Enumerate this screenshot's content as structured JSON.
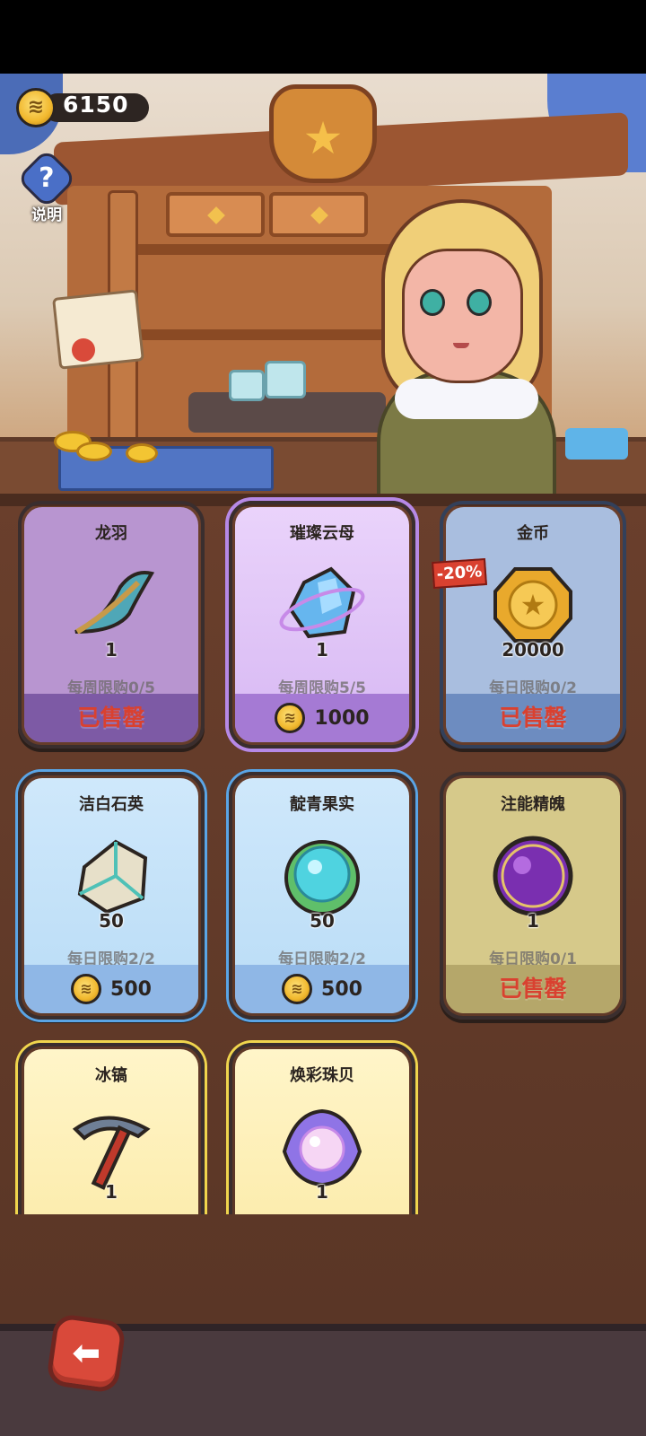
{
  "hud": {
    "currency_icon": "gold-crystal-coin-icon",
    "currency_value": "6150",
    "help_label": "说明",
    "help_icon": "question-icon"
  },
  "shop": {
    "items": [
      {
        "name": "龙羽",
        "icon": "dragon-feather-icon",
        "qty": "1",
        "limit": "每周限购0/5",
        "status": "sold",
        "sold_label": "已售罄",
        "theme": "purple"
      },
      {
        "name": "璀璨云母",
        "icon": "mica-crystal-icon",
        "qty": "1",
        "limit": "每周限购5/5",
        "status": "price",
        "price": "1000",
        "theme": "violet"
      },
      {
        "name": "金币",
        "icon": "gold-coin-star-icon",
        "qty": "20000",
        "limit": "每日限购0/2",
        "status": "sold",
        "sold_label": "已售罄",
        "discount": "-20%",
        "theme": "blue"
      },
      {
        "name": "洁白石英",
        "icon": "white-quartz-icon",
        "qty": "50",
        "limit": "每日限购2/2",
        "status": "price",
        "price": "500",
        "theme": "sky"
      },
      {
        "name": "靛青果实",
        "icon": "indigo-fruit-icon",
        "qty": "50",
        "limit": "每日限购2/2",
        "status": "price",
        "price": "500",
        "theme": "sky"
      },
      {
        "name": "注能精魄",
        "icon": "energy-orb-icon",
        "qty": "1",
        "limit": "每日限购0/1",
        "status": "sold",
        "sold_label": "已售罄",
        "theme": "olive"
      },
      {
        "name": "冰镐",
        "icon": "ice-pickaxe-icon",
        "qty": "1",
        "theme": "yellow"
      },
      {
        "name": "焕彩珠贝",
        "icon": "pearl-shell-icon",
        "qty": "1",
        "theme": "yellow"
      }
    ]
  },
  "nav": {
    "back_icon": "back-arrow-icon",
    "back_glyph": "⬅"
  }
}
